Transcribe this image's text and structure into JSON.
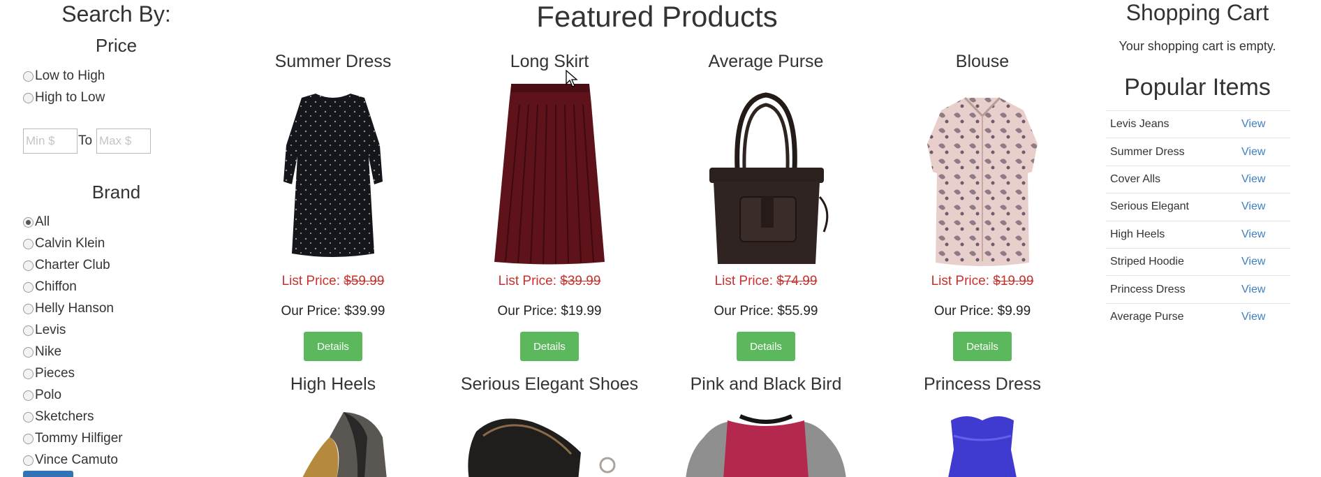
{
  "sidebar": {
    "search_by": "Search By:",
    "price_heading": "Price",
    "sort_options": [
      {
        "label": "Low to High",
        "checked": false
      },
      {
        "label": "High to Low",
        "checked": false
      }
    ],
    "min_placeholder": "Min $",
    "to_label": "To",
    "max_placeholder": "Max $",
    "brand_heading": "Brand",
    "brands": [
      {
        "label": "All",
        "checked": true
      },
      {
        "label": "Calvin Klein",
        "checked": false
      },
      {
        "label": "Charter Club",
        "checked": false
      },
      {
        "label": "Chiffon",
        "checked": false
      },
      {
        "label": "Helly Hanson",
        "checked": false
      },
      {
        "label": "Levis",
        "checked": false
      },
      {
        "label": "Nike",
        "checked": false
      },
      {
        "label": "Pieces",
        "checked": false
      },
      {
        "label": "Polo",
        "checked": false
      },
      {
        "label": "Sketchers",
        "checked": false
      },
      {
        "label": "Tommy Hilfiger",
        "checked": false
      },
      {
        "label": "Vince Camuto",
        "checked": false
      }
    ]
  },
  "main": {
    "title": "Featured Products",
    "products": [
      {
        "name": "Summer Dress",
        "list_label": "List Price:",
        "list_price": "$59.99",
        "our_label": "Our Price:",
        "our_price": "$39.99",
        "button": "Details"
      },
      {
        "name": "Long Skirt",
        "list_label": "List Price:",
        "list_price": "$39.99",
        "our_label": "Our Price:",
        "our_price": "$19.99",
        "button": "Details"
      },
      {
        "name": "Average Purse",
        "list_label": "List Price:",
        "list_price": "$74.99",
        "our_label": "Our Price:",
        "our_price": "$55.99",
        "button": "Details"
      },
      {
        "name": "Blouse",
        "list_label": "List Price:",
        "list_price": "$19.99",
        "our_label": "Our Price:",
        "our_price": "$9.99",
        "button": "Details"
      }
    ],
    "products_row2": [
      {
        "name": "High Heels"
      },
      {
        "name": "Serious Elegant Shoes"
      },
      {
        "name": "Pink and Black Bird"
      },
      {
        "name": "Princess Dress"
      }
    ]
  },
  "cart": {
    "title": "Shopping Cart",
    "empty_text": "Your shopping cart is empty."
  },
  "popular": {
    "title": "Popular Items",
    "items": [
      {
        "name": "Levis Jeans",
        "link": "View"
      },
      {
        "name": "Summer Dress",
        "link": "View"
      },
      {
        "name": "Cover Alls",
        "link": "View"
      },
      {
        "name": "Serious Elegant",
        "link": "View"
      },
      {
        "name": "High Heels",
        "link": "View"
      },
      {
        "name": "Striped Hoodie",
        "link": "View"
      },
      {
        "name": "Princess Dress",
        "link": "View"
      },
      {
        "name": "Average Purse",
        "link": "View"
      }
    ]
  },
  "colors": {
    "list_price": "#c9302c",
    "details_button": "#5cb85c",
    "link": "#3f7ec0",
    "search_button": "#3174b6"
  }
}
